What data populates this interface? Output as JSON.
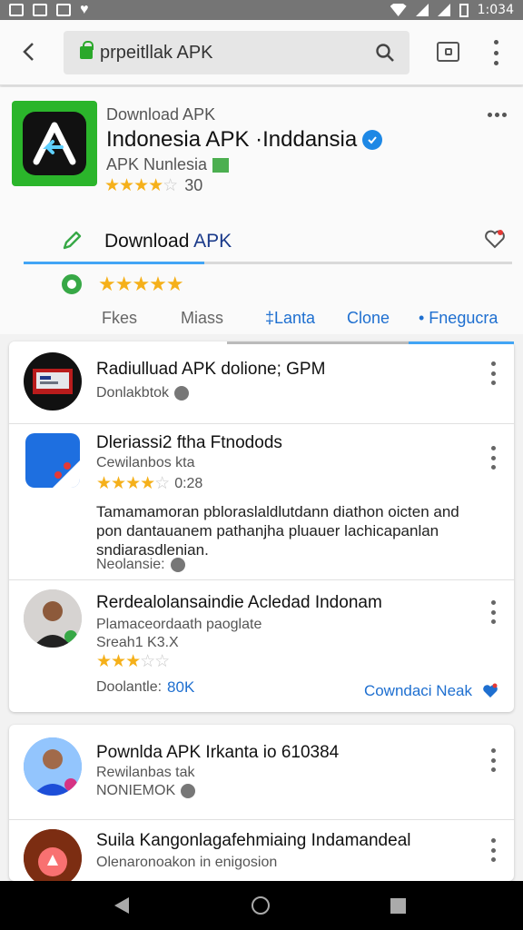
{
  "status_bar": {
    "time": "1:034"
  },
  "browser": {
    "url": "prpeitllak APK"
  },
  "app": {
    "overline": "Download APK",
    "title": "Indonesia APK ·Inddansia",
    "publisher": "APK Nunlesia",
    "rating_count": "30",
    "rating_stars": 4,
    "download_label_main": "Download",
    "download_label_accent": "APK",
    "progress": 0.37,
    "brand_color": "#2bb52b",
    "accent_color": "#1e6fd0"
  },
  "filters": [
    "Fkes",
    "Miass",
    "‡Lanta",
    "Clone",
    "• Fnegucra"
  ],
  "list1": [
    {
      "title": "Radiulluad APK dolione; GPM",
      "sub": "Donlakbtok",
      "icon": "news-avatar"
    },
    {
      "title": "Dleriassi2 ftha Ftnodods",
      "sub": "Cewilanbos kta",
      "rating_stars": 4,
      "rating_text": "0:28",
      "body": "Tamamamoran pbloraslaldlutdann diathon oicten and pon dantauanem pathanjha pluauer lachicapanlan sndiarasdlenian.",
      "footer": "Neolansie:",
      "icon": "blue-app-icon"
    },
    {
      "title": "Rerdealolansaindie Acledad Indonam",
      "sub": "Plamaceordaath paoglate",
      "sub2": "Sreah1 K3.X",
      "rating_stars": 3,
      "footer_label": "Doolantle:",
      "footer_value": "80K",
      "action": "Cowndaci Neak",
      "icon": "person-avatar"
    }
  ],
  "list2": [
    {
      "title": "Pownlda APK Irkanta io 610384",
      "sub": "Rewilanbas tak",
      "sub2": "NONIEMOK",
      "icon": "person-avatar-2"
    },
    {
      "title": "Suila Kangonlagafehmiaing Indamandeal",
      "sub": "Olenaronoakon in enigosion",
      "icon": "game-avatar"
    }
  ]
}
